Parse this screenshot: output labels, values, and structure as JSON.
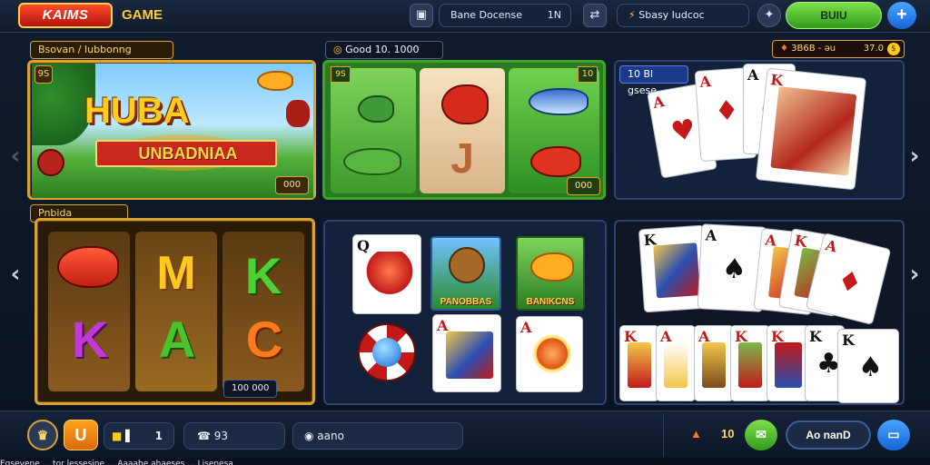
{
  "topbar": {
    "logo": "KAIMS",
    "logo_sub": "GAME",
    "search_label": "Bane Docense",
    "search_value": "1N",
    "wallet_label": "Sbasy Iudcoc",
    "green_button": "BUIU",
    "blue_button": "+"
  },
  "sections": {
    "featured_tag": "Bsovan / Iubbonng",
    "featured_chip": "000",
    "featured_title": "HUBA",
    "featured_ribbon": "UNBADNIAA",
    "green_tag": "Good 10. 1000",
    "green_corner": "10",
    "green_chip": "000",
    "jackpot_left": "3B6B - ǝu",
    "jackpot_right": "37.0",
    "card_tag": "10 Bl gsese",
    "slot_tag": "Pnbida",
    "slot_chip": "100 000",
    "green_corner_left": "9S"
  },
  "mini_games": [
    {
      "label": "PANOBBAS"
    },
    {
      "label": "BANIKCNS"
    }
  ],
  "bottombar": {
    "level": "U",
    "coins": "1",
    "field1": "93",
    "field2": "aano",
    "bet": "10",
    "button": "Ao nanD"
  },
  "footer": "Egsevene ... tor lessesine ... Aaaahe ahaeses ... Lisenesa"
}
